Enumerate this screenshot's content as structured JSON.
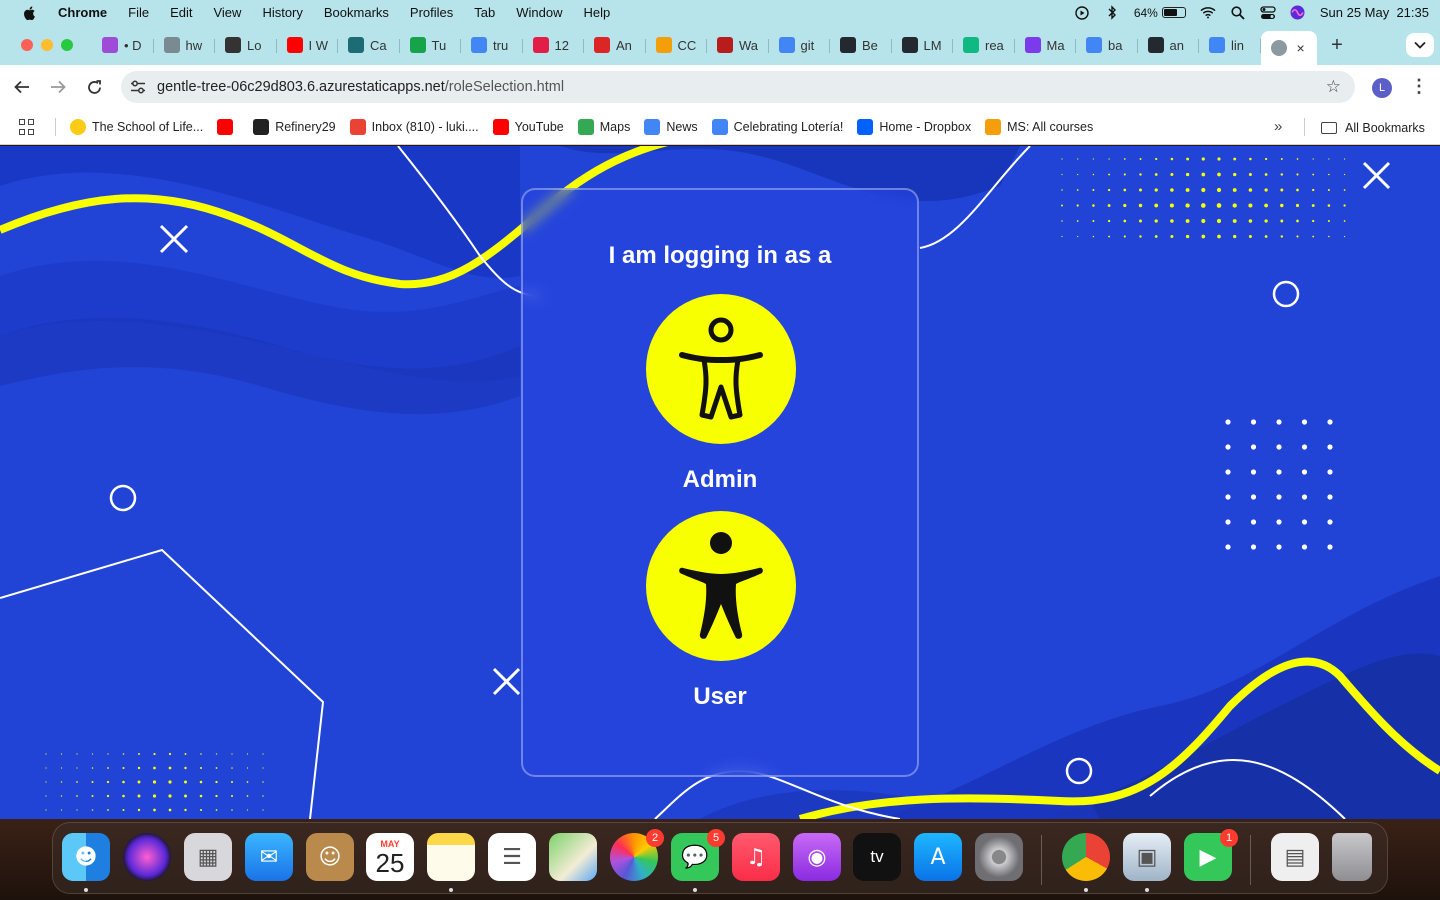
{
  "menubar": {
    "app_name": "Chrome",
    "menus": [
      "File",
      "Edit",
      "View",
      "History",
      "Bookmarks",
      "Profiles",
      "Tab",
      "Window",
      "Help"
    ],
    "battery_percent": "64%",
    "battery_level": 0.64,
    "datetime": "Sun 25 May  21:35"
  },
  "tabs": [
    {
      "label": "• D",
      "icon": "messenger-icon",
      "color": "#a04bd8"
    },
    {
      "label": "hw",
      "icon": "globe-icon",
      "color": "#7a8a90"
    },
    {
      "label": "Lo",
      "icon": "openai-icon",
      "color": "#333333"
    },
    {
      "label": "I W",
      "icon": "youtube-icon",
      "color": "#ff0000"
    },
    {
      "label": "Ca",
      "icon": "terminal-icon",
      "color": "#1f6b75"
    },
    {
      "label": "Tu",
      "icon": "plus-icon",
      "color": "#16a34a"
    },
    {
      "label": "tru",
      "icon": "google-icon",
      "color": "#4285f4"
    },
    {
      "label": "12",
      "icon": "recycle-icon",
      "color": "#e11d48"
    },
    {
      "label": "An",
      "icon": "ring-icon",
      "color": "#dc2626"
    },
    {
      "label": "CC",
      "icon": "moodle-icon",
      "color": "#f59e0b"
    },
    {
      "label": "Wa",
      "icon": "video-icon",
      "color": "#b91c1c"
    },
    {
      "label": "git",
      "icon": "google-icon",
      "color": "#4285f4"
    },
    {
      "label": "Be",
      "icon": "github-icon",
      "color": "#24292f"
    },
    {
      "label": "LM",
      "icon": "github-icon",
      "color": "#24292f"
    },
    {
      "label": "rea",
      "icon": "grid-icon",
      "color": "#10b981"
    },
    {
      "label": "Ma",
      "icon": "arc-icon",
      "color": "#7c3aed"
    },
    {
      "label": "ba",
      "icon": "google-icon",
      "color": "#4285f4"
    },
    {
      "label": "an",
      "icon": "github-icon",
      "color": "#24292f"
    },
    {
      "label": "lin",
      "icon": "google-icon",
      "color": "#4285f4"
    }
  ],
  "active_tab": {
    "icon": "globe-icon",
    "close": "×"
  },
  "toolbar": {
    "url_host": "gentle-tree-06c29d803.6.azurestaticapps.net",
    "url_path": "/roleSelection.html",
    "profile_initial": "L"
  },
  "bookmarks": [
    {
      "label": "The School of Life...",
      "icon": "yellow-circle-icon",
      "color": "#facc15"
    },
    {
      "label": "",
      "icon": "youtube-icon",
      "color": "#ff0000"
    },
    {
      "label": "Refinery29",
      "icon": "refinery29-icon",
      "color": "#222222"
    },
    {
      "label": "Inbox (810) - luki....",
      "icon": "gmail-icon",
      "color": "#ea4335"
    },
    {
      "label": "YouTube",
      "icon": "youtube-icon",
      "color": "#ff0000"
    },
    {
      "label": "Maps",
      "icon": "maps-icon",
      "color": "#34a853"
    },
    {
      "label": "News",
      "icon": "news-icon",
      "color": "#4285f4"
    },
    {
      "label": "Celebrating Lotería!",
      "icon": "google-icon",
      "color": "#4285f4"
    },
    {
      "label": "Home - Dropbox",
      "icon": "dropbox-icon",
      "color": "#0061fe"
    },
    {
      "label": "MS: All courses",
      "icon": "moodle-icon",
      "color": "#f59e0b"
    }
  ],
  "bookmarks_all": "All Bookmarks",
  "page": {
    "title": "I am logging in as a",
    "roles": [
      {
        "label": "Admin",
        "icon": "accessibility-outline-icon"
      },
      {
        "label": "User",
        "icon": "accessibility-solid-icon"
      }
    ],
    "colors": {
      "background": "#2144d6",
      "accent": "#f7ff00",
      "card_text": "#ffffff"
    }
  },
  "dock": {
    "apps": [
      {
        "name": "Finder",
        "icon": "finder-icon"
      },
      {
        "name": "Siri",
        "icon": "siri-icon"
      },
      {
        "name": "Launchpad",
        "icon": "launchpad-icon"
      },
      {
        "name": "Mail",
        "icon": "mail-icon"
      },
      {
        "name": "Contacts",
        "icon": "contacts-icon"
      },
      {
        "name": "Calendar",
        "icon": "calendar-icon",
        "month": "MAY",
        "day": "25"
      },
      {
        "name": "Notes",
        "icon": "notes-icon"
      },
      {
        "name": "Reminders",
        "icon": "reminders-icon"
      },
      {
        "name": "Maps",
        "icon": "maps-icon"
      },
      {
        "name": "Photos",
        "icon": "photos-icon",
        "badge": "2"
      },
      {
        "name": "Messages",
        "icon": "messages-icon",
        "badge": "5"
      },
      {
        "name": "Music",
        "icon": "music-icon"
      },
      {
        "name": "Podcasts",
        "icon": "podcasts-icon"
      },
      {
        "name": "TV",
        "icon": "tv-icon",
        "text": "tv"
      },
      {
        "name": "App Store",
        "icon": "appstore-icon"
      },
      {
        "name": "System Settings",
        "icon": "settings-icon"
      },
      {
        "name": "Chrome",
        "icon": "chrome-icon"
      },
      {
        "name": "Preview",
        "icon": "preview-icon"
      },
      {
        "name": "FaceTime",
        "icon": "facetime-icon",
        "badge": "1"
      },
      {
        "name": "Documents",
        "icon": "document-stack-icon"
      },
      {
        "name": "Trash",
        "icon": "trash-icon"
      }
    ]
  }
}
